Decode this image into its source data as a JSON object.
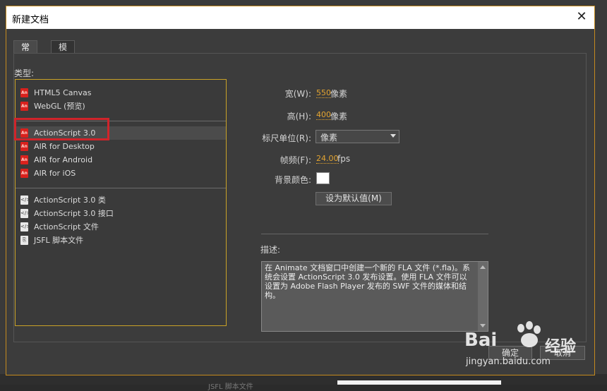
{
  "window": {
    "title": "新建文档",
    "close": "✕"
  },
  "tabs": [
    {
      "label": "常规"
    },
    {
      "label": "模板"
    }
  ],
  "type_section": {
    "label": "类型:",
    "items": [
      {
        "label": "HTML5 Canvas",
        "icon": "an-icon"
      },
      {
        "label": "WebGL (预览)",
        "icon": "an-icon"
      },
      {
        "label": "ActionScript 3.0",
        "icon": "an-icon",
        "selected": true
      },
      {
        "label": "AIR for Desktop",
        "icon": "an-icon"
      },
      {
        "label": "AIR for Android",
        "icon": "an-icon"
      },
      {
        "label": "AIR for iOS",
        "icon": "an-icon"
      },
      {
        "label": "ActionScript 3.0 类",
        "icon": "script-file-icon"
      },
      {
        "label": "ActionScript 3.0 接口",
        "icon": "script-file-icon"
      },
      {
        "label": "ActionScript 文件",
        "icon": "script-file-icon"
      },
      {
        "label": "JSFL 脚本文件",
        "icon": "jsfl-file-icon"
      }
    ]
  },
  "properties": {
    "width_label": "宽(W):",
    "width_value": "550",
    "width_unit": "像素",
    "height_label": "高(H):",
    "height_value": "400",
    "height_unit": "像素",
    "ruler_label": "标尺单位(R):",
    "ruler_value": "像素",
    "fps_label": "帧频(F):",
    "fps_value": "24.00",
    "fps_unit": "fps",
    "bg_label": "背景颜色:",
    "bg_color": "#ffffff",
    "default_button": "设为默认值(M)"
  },
  "description": {
    "label": "描述:",
    "text": "在 Animate 文档窗口中创建一个新的 FLA 文件 (*.fla)。系统会设置 ActionScript 3.0 发布设置。使用 FLA 文件可以设置为 Adobe Flash Player 发布的 SWF 文件的媒体和结构。"
  },
  "buttons": {
    "ok": "确定",
    "cancel": "取消"
  },
  "watermark": {
    "brand": "Bai",
    "brand2": "经验",
    "url": "jingyan.baidu.com"
  },
  "background": {
    "ghost_text": "JSFL 脚本文件"
  },
  "colors": {
    "accent": "#c9a227",
    "highlight": "#d0242a",
    "value": "#e3a431"
  }
}
